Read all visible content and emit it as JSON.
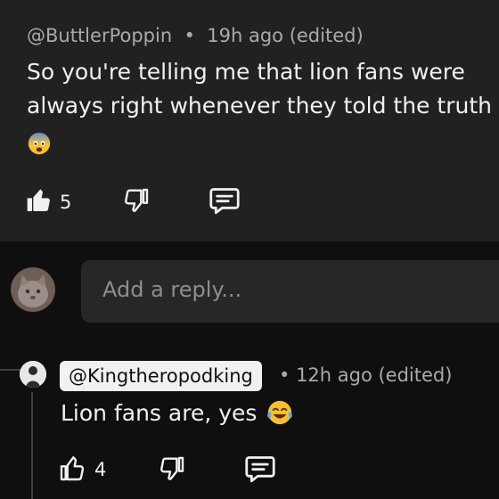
{
  "comment": {
    "author": "@ButtlerPoppin",
    "time": "19h ago (edited)",
    "line1": "So you're telling me that lion fans were",
    "line2": "always right whenever they told the truth",
    "emoji": "fearful-face",
    "likes": "5"
  },
  "reply_box": {
    "placeholder": "Add a reply..."
  },
  "reply": {
    "author": "@Kingtheropodking",
    "time": "12h ago (edited)",
    "text": "Lion fans are, yes",
    "emoji": "tears-of-joy",
    "likes": "4"
  },
  "colors": {
    "background": "#0f0f0f",
    "card": "#212121",
    "input": "#272727",
    "secondary_text": "#aaaaaa",
    "emoji_yellow": "#f7c02f"
  }
}
